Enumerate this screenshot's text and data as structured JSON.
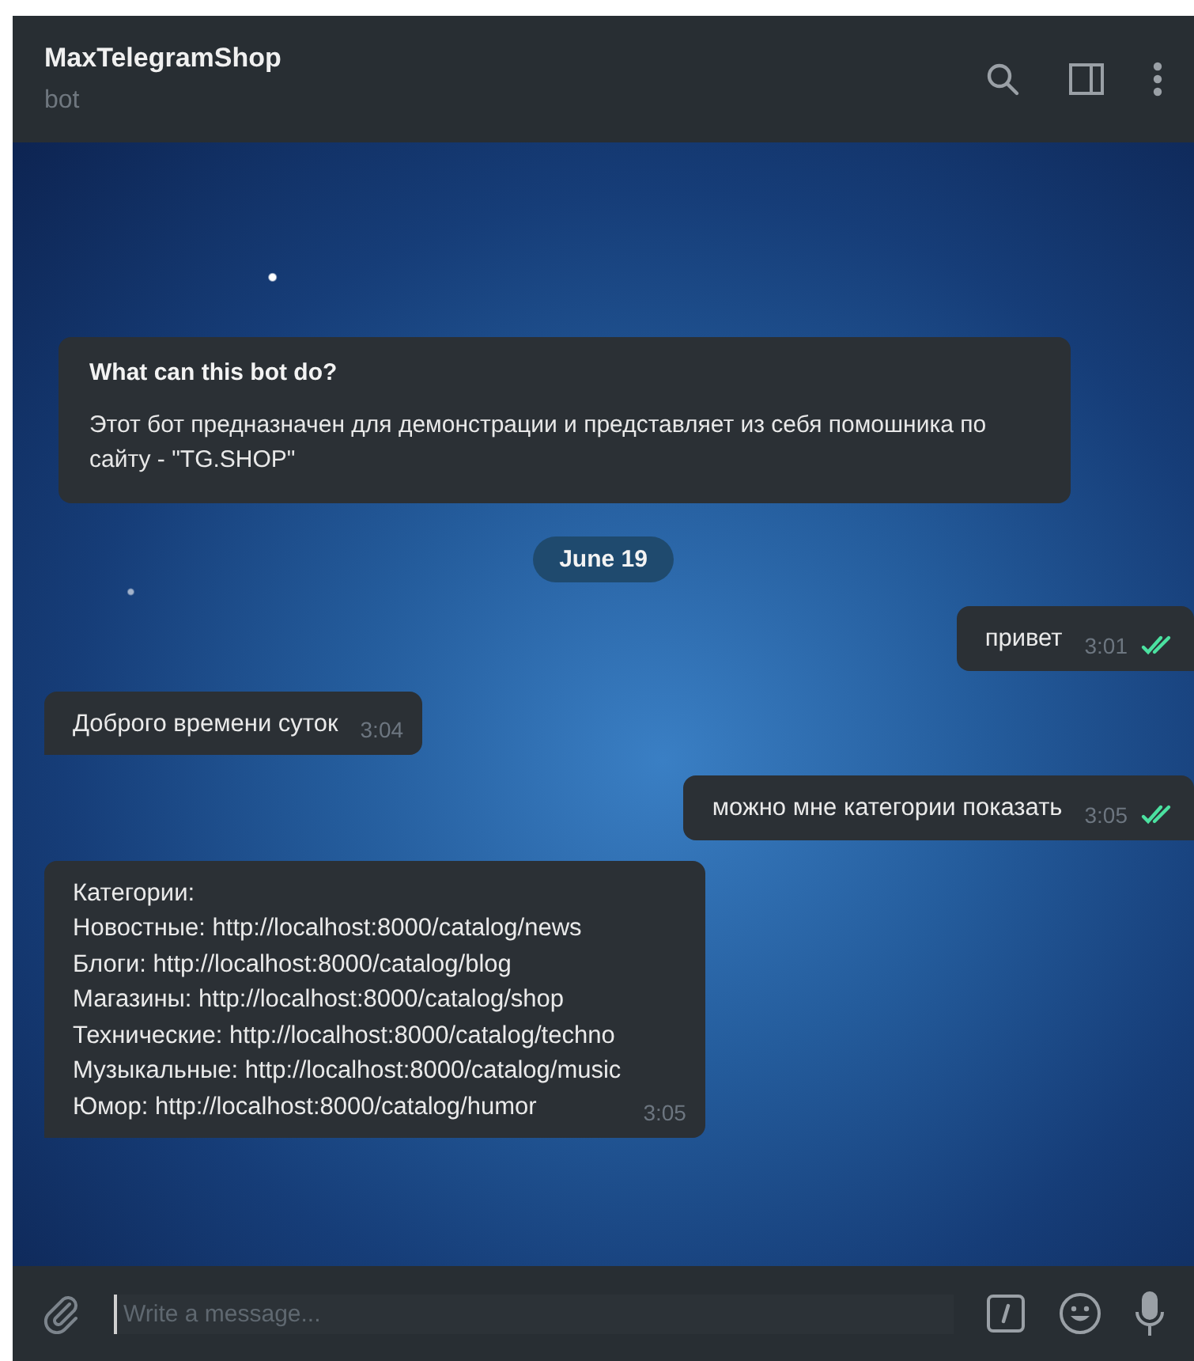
{
  "header": {
    "title": "MaxTelegramShop",
    "subtitle": "bot"
  },
  "bot_info": {
    "title": "What can this bot do?",
    "text": "Этот бот предназначен для демонстрации и представляет из себя помошника по сайту - \"TG.SHOP\""
  },
  "date_label": "June 19",
  "messages": [
    {
      "kind": "out",
      "lines": [
        "привет"
      ],
      "time": "3:01",
      "read": true
    },
    {
      "kind": "in",
      "lines": [
        "Доброго времени суток"
      ],
      "time": "3:04"
    },
    {
      "kind": "out",
      "lines": [
        "можно мне категории показать"
      ],
      "time": "3:05",
      "read": true
    },
    {
      "kind": "in",
      "lines": [
        "Категории:",
        "Новостные: http://localhost:8000/catalog/news",
        "Блоги: http://localhost:8000/catalog/blog",
        "Магазины: http://localhost:8000/catalog/shop",
        "Технические: http://localhost:8000/catalog/techno",
        "Музыкальные: http://localhost:8000/catalog/music",
        "Юмор: http://localhost:8000/catalog/humor"
      ],
      "time": "3:05"
    }
  ],
  "composer": {
    "placeholder": "Write a message..."
  }
}
